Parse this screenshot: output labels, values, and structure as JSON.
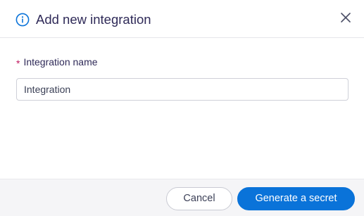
{
  "dialog": {
    "title": "Add new integration",
    "icons": {
      "title_icon": "info-icon",
      "close": "close-icon"
    },
    "colors": {
      "accent": "#0a73d9",
      "title_text": "#2f2a58",
      "required_marker": "#c0185f",
      "footer_bg": "#f5f5f7"
    }
  },
  "form": {
    "integration_name": {
      "required_marker": "*",
      "label": "Integration name",
      "value": "Integration"
    }
  },
  "footer": {
    "cancel_label": "Cancel",
    "submit_label": "Generate a secret"
  }
}
